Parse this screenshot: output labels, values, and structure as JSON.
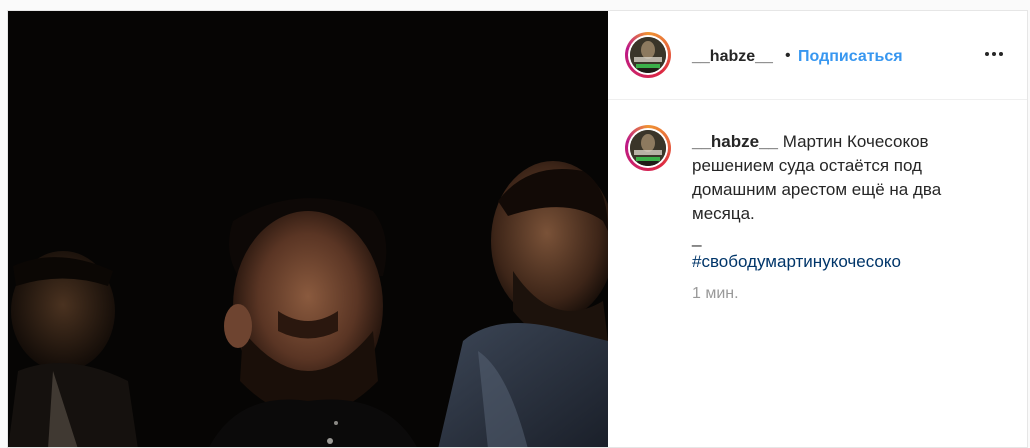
{
  "header": {
    "username": "__habze__",
    "separator": "•",
    "follow_label": "Подписаться"
  },
  "comment": {
    "username": "__habze__",
    "text_line1": "Мартин Кочесоков",
    "text_line2": "решением суда остаётся под",
    "text_line3": "домашним арестом ещё на два",
    "text_line4": "месяца.",
    "text_line5": "_",
    "hashtag": "#свободумартинукочесоко",
    "timestamp": "1 мин."
  },
  "colors": {
    "follow": "#3897f0",
    "hashtag": "#003569",
    "timestamp": "#999999",
    "text": "#262626"
  },
  "icons": {
    "more": "more-options-icon",
    "avatar": "profile-avatar"
  }
}
